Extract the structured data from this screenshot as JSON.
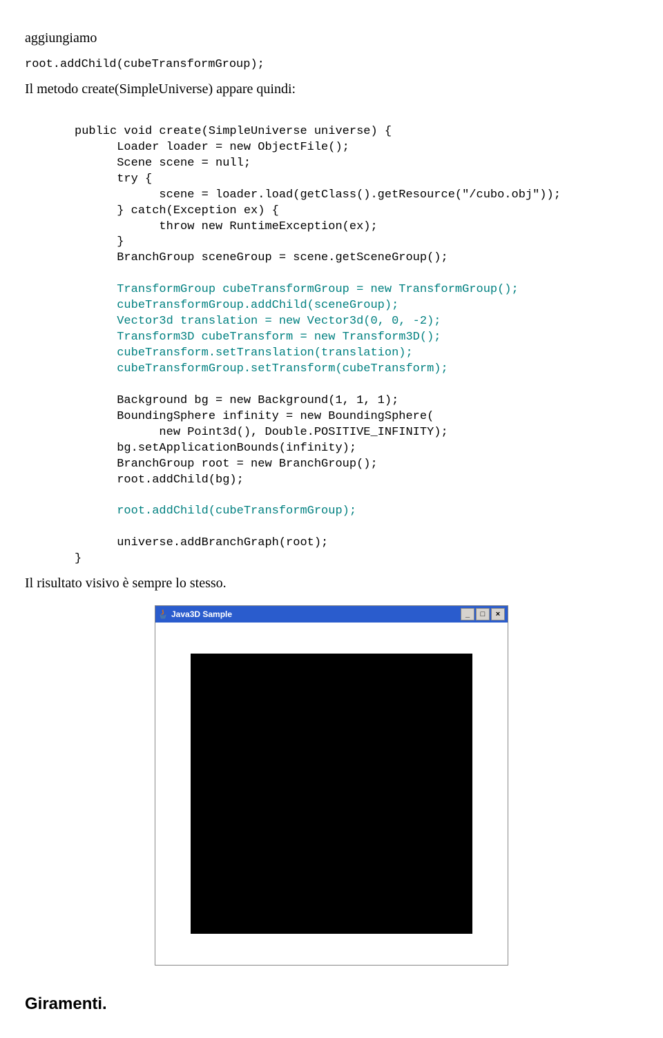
{
  "para1": "aggiungiamo",
  "codeLine1": "root.addChild(cubeTransformGroup);",
  "para2": "Il metodo create(SimpleUniverse) appare quindi:",
  "code": {
    "blk1": "public void create(SimpleUniverse universe) {\n      Loader loader = new ObjectFile();\n      Scene scene = null;\n      try {\n            scene = loader.load(getClass().getResource(\"/cubo.obj\"));\n      } catch(Exception ex) {\n            throw new RuntimeException(ex);\n      }\n      BranchGroup sceneGroup = scene.getSceneGroup();",
    "blk2": "      TransformGroup cubeTransformGroup = new TransformGroup();\n      cubeTransformGroup.addChild(sceneGroup);\n      Vector3d translation = new Vector3d(0, 0, -2);\n      Transform3D cubeTransform = new Transform3D();\n      cubeTransform.setTranslation(translation);\n      cubeTransformGroup.setTransform(cubeTransform);",
    "blk3": "      Background bg = new Background(1, 1, 1);\n      BoundingSphere infinity = new BoundingSphere(\n            new Point3d(), Double.POSITIVE_INFINITY);\n      bg.setApplicationBounds(infinity);\n      BranchGroup root = new BranchGroup();\n      root.addChild(bg);",
    "blk4": "      root.addChild(cubeTransformGroup);",
    "blk5": "      universe.addBranchGraph(root);\n}"
  },
  "para3": "Il risultato visivo è sempre lo stesso.",
  "window": {
    "title": "Java3D Sample",
    "minimize": "_",
    "maximize": "□",
    "close": "×"
  },
  "heading": "Giramenti."
}
